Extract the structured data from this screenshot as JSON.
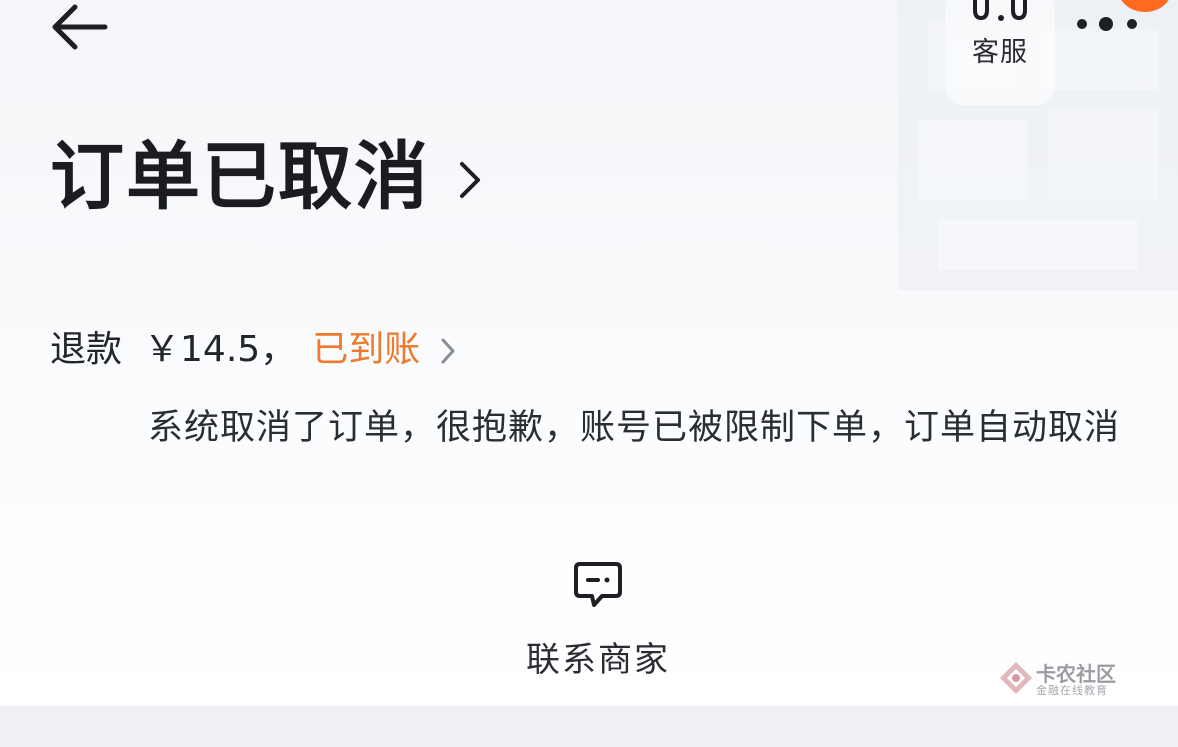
{
  "header": {
    "back_icon": "arrow-left-icon",
    "service_label": "客服",
    "service_icon": "headset-icon",
    "more_icon": "more-dots-icon"
  },
  "status": {
    "title": "订单已取消",
    "title_chevron": "chevron-right-icon"
  },
  "refund": {
    "label": "退款",
    "amount": "￥14.5",
    "separator": "，",
    "status": "已到账",
    "status_color": "#ee7a2e"
  },
  "reason": {
    "text": "系统取消了订单，很抱歉，账号已被限制下单，订单自动取消"
  },
  "contact": {
    "label": "联系商家",
    "icon": "chat-bubble-icon"
  },
  "watermark": {
    "brand": "卡农社区",
    "tagline": "金融在线教育"
  },
  "colors": {
    "accent": "#ff6a1f",
    "text_primary": "#1a1c22"
  }
}
